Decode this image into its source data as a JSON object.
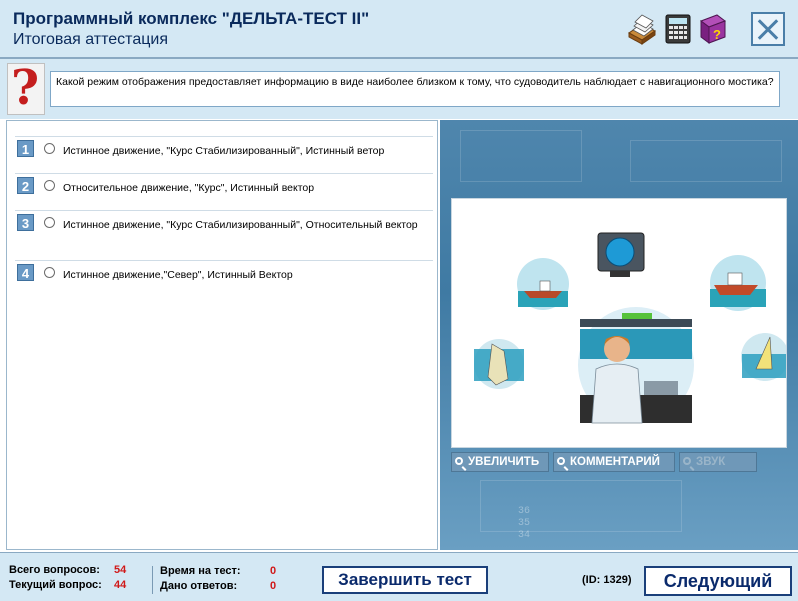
{
  "header": {
    "title": "Программный комплекс \"ДЕЛЬТА-ТЕСТ II\"",
    "subtitle": "Итоговая аттестация",
    "icons": [
      "notes-icon",
      "calculator-icon",
      "help-book-icon"
    ],
    "close_icon": "close-icon"
  },
  "question": {
    "icon": "question-mark-icon",
    "text": "Какой режим отображения предоставляет информацию в виде наиболее близком к тому, что судоводитель наблюдает с навигационного мостика?"
  },
  "answers": [
    {
      "number": "1",
      "text": "Истинное движение, \"Курс Стабилизированный\", Истинный ветор"
    },
    {
      "number": "2",
      "text": "Относительное движение, \"Курс\", Истинный вектор"
    },
    {
      "number": "3",
      "text": "Истинное движение, \"Курс Стабилизированный\", Относительный вектор"
    },
    {
      "number": "4",
      "text": "Истинное движение,\"Север\", Истинный Вектор"
    }
  ],
  "image_panel": {
    "buttons": {
      "zoom": "УВЕЛИЧИТЬ",
      "comments": "КОММЕНТАРИЙ",
      "sound": "ЗВУК"
    },
    "background_numbers": [
      "36",
      "35",
      "34"
    ]
  },
  "footer": {
    "total_questions_label": "Всего вопросов:",
    "total_questions": "54",
    "current_question_label": "Текущий вопрос:",
    "current_question": "44",
    "time_label": "Время на тест:",
    "time_value": "0",
    "answered_label": "Дано ответов:",
    "answered_value": "0",
    "finish_button": "Завершить тест",
    "id_label": "(ID: 1329)",
    "next_button": "Следующий"
  },
  "colors": {
    "panel_bg": "#d4e8f4",
    "title_text": "#0a2a5c",
    "accent_red": "#d01818",
    "number_badge": "#6a9ac6"
  }
}
